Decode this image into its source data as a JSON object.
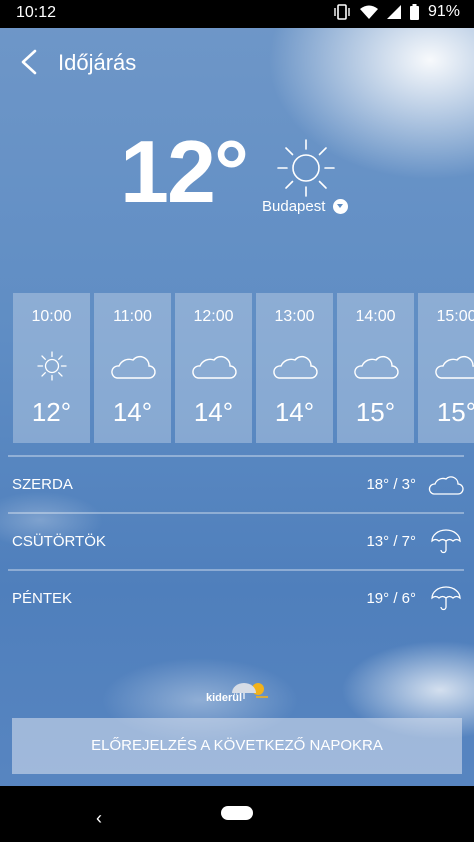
{
  "status": {
    "time": "10:12",
    "battery": "91%"
  },
  "header": {
    "title": "Időjárás"
  },
  "current": {
    "temp": "12°",
    "city": "Budapest"
  },
  "hourly": [
    {
      "time": "10:00",
      "icon": "sun-icon",
      "temp": "12°"
    },
    {
      "time": "11:00",
      "icon": "cloud-icon",
      "temp": "14°"
    },
    {
      "time": "12:00",
      "icon": "cloud-icon",
      "temp": "14°"
    },
    {
      "time": "13:00",
      "icon": "cloud-icon",
      "temp": "14°"
    },
    {
      "time": "14:00",
      "icon": "cloud-icon",
      "temp": "15°"
    },
    {
      "time": "15:00",
      "icon": "cloud-icon",
      "temp": "15°"
    }
  ],
  "daily": [
    {
      "day": "SZERDA",
      "temps": "18° / 3°",
      "icon": "cloud-icon"
    },
    {
      "day": "CSÜTÖRTÖK",
      "temps": "13° / 7°",
      "icon": "umbrella-icon"
    },
    {
      "day": "PÉNTEK",
      "temps": "19° / 6°",
      "icon": "umbrella-icon"
    }
  ],
  "brand": {
    "logo_text": "kiderül"
  },
  "footer": {
    "forecast_button": "ELŐREJELZÉS A KÖVETKEZŐ NAPOKRA"
  },
  "colors": {
    "sky": "#5f8dc4",
    "text": "#ffffff",
    "logo_accent": "#f2b21b"
  }
}
